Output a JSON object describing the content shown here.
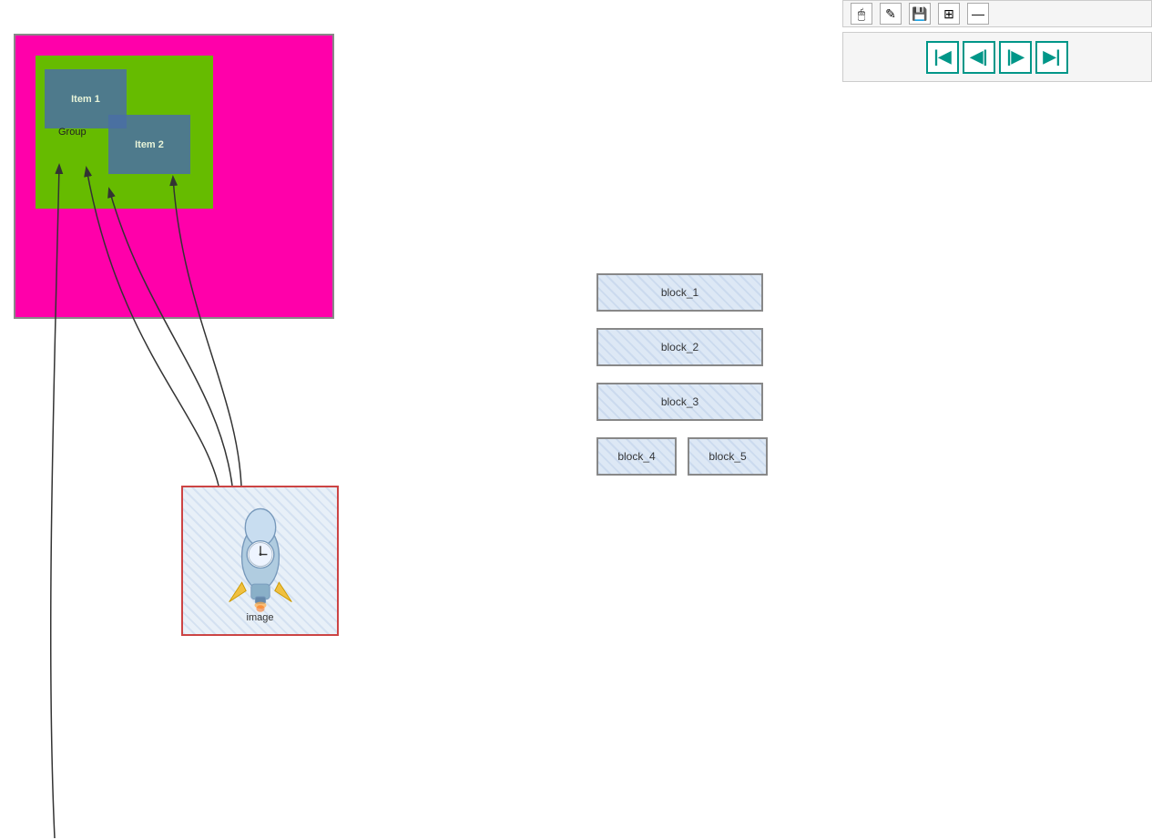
{
  "toolbar": {
    "buttons": [
      {
        "name": "cursor-icon",
        "symbol": "🖱"
      },
      {
        "name": "edit-icon",
        "symbol": "✎"
      },
      {
        "name": "save-icon",
        "symbol": "💾"
      },
      {
        "name": "grid-icon",
        "symbol": "⊞"
      },
      {
        "name": "minus-icon",
        "symbol": "—"
      }
    ]
  },
  "nav": {
    "first_label": "|◀",
    "prev_label": "◀|",
    "next_label": "|▶",
    "last_label": "▶|"
  },
  "diagram": {
    "item1_label": "Item 1",
    "item2_label": "Item 2",
    "group_label": "Group",
    "image_label": "image"
  },
  "blocks": [
    {
      "id": "block_1",
      "label": "block_1",
      "wide": true
    },
    {
      "id": "block_2",
      "label": "block_2",
      "wide": true
    },
    {
      "id": "block_3",
      "label": "block_3",
      "wide": true
    },
    {
      "id": "block_4",
      "label": "block_4",
      "wide": false
    },
    {
      "id": "block_5",
      "label": "block_5",
      "wide": false
    }
  ]
}
